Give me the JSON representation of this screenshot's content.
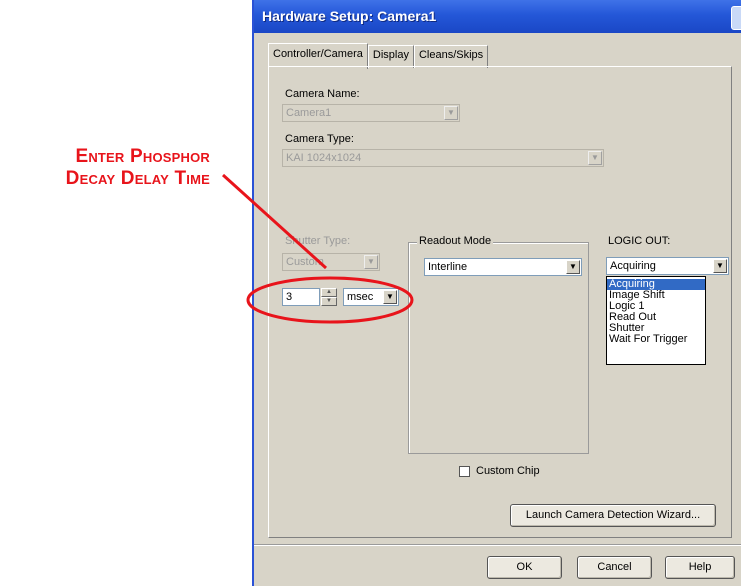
{
  "annotation": {
    "line1": "Enter Phosphor",
    "line2": "Decay Delay Time",
    "color": "#e8141b"
  },
  "window": {
    "title": "Hardware Setup: Camera1"
  },
  "tabs": [
    {
      "label": "Controller/Camera"
    },
    {
      "label": "Display"
    },
    {
      "label": "Cleans/Skips"
    }
  ],
  "camera_name": {
    "label": "Camera Name:",
    "value": "Camera1"
  },
  "camera_type": {
    "label": "Camera Type:",
    "value": "KAI 1024x1024"
  },
  "shutter_type": {
    "label": "Shutter Type:",
    "value": "Custom"
  },
  "delay": {
    "value": "3",
    "unit": "msec"
  },
  "readout_mode": {
    "label": "Readout Mode",
    "value": "Interline"
  },
  "logic_out": {
    "label": "LOGIC OUT:",
    "value": "Acquiring",
    "options": [
      "Acquiring",
      "Image Shift",
      "Logic 1",
      "Read Out",
      "Shutter",
      "Wait For Trigger"
    ],
    "selected_index": 0
  },
  "custom_chip": {
    "label": "Custom Chip",
    "checked": false
  },
  "launch_wizard": {
    "label": "Launch Camera Detection Wizard..."
  },
  "buttons": {
    "ok": "OK",
    "cancel": "Cancel",
    "help": "Help"
  },
  "colors": {
    "titlebar": "#2457d8",
    "selection": "#316ac5",
    "dialog_bg": "#d8d4c8"
  }
}
